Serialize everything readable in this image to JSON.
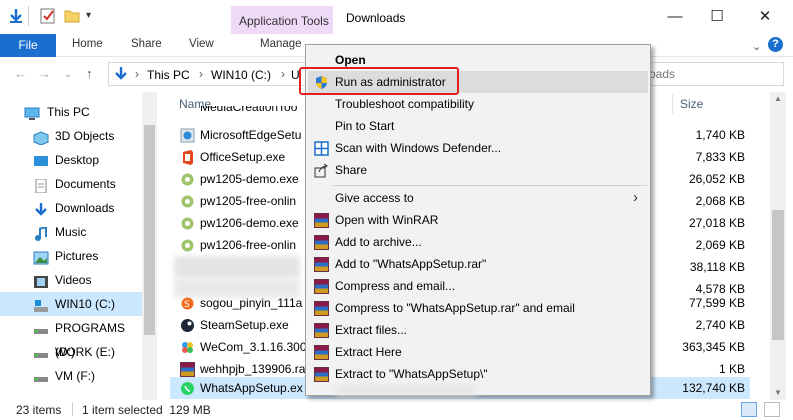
{
  "window": {
    "title": "Downloads",
    "app_tools_tab": "Application Tools",
    "controls": {
      "minimize": "—",
      "maximize": "☐",
      "close": "✕"
    }
  },
  "ribbon": {
    "file": "File",
    "home": "Home",
    "share": "Share",
    "view": "View",
    "manage": "Manage"
  },
  "address": {
    "crumbs": [
      "This PC",
      "WIN10 (C:)",
      "U"
    ],
    "search_placeholder": "oads"
  },
  "nav": {
    "items": [
      {
        "label": "This PC",
        "icon": "monitor-icon"
      },
      {
        "label": "3D Objects",
        "icon": "cube-icon"
      },
      {
        "label": "Desktop",
        "icon": "desktop-icon"
      },
      {
        "label": "Documents",
        "icon": "documents-icon"
      },
      {
        "label": "Downloads",
        "icon": "download-arrow-icon"
      },
      {
        "label": "Music",
        "icon": "music-icon"
      },
      {
        "label": "Pictures",
        "icon": "pictures-icon"
      },
      {
        "label": "Videos",
        "icon": "videos-icon"
      },
      {
        "label": "WIN10 (C:)",
        "icon": "drive-icon"
      },
      {
        "label": "PROGRAMS (D:)",
        "icon": "drive-icon"
      },
      {
        "label": "WORK (E:)",
        "icon": "drive-icon"
      },
      {
        "label": "VM (F:)",
        "icon": "drive-icon"
      }
    ],
    "selected": "WIN10 (C:)"
  },
  "files": {
    "col_name": "Name",
    "col_size": "Size",
    "rows": [
      {
        "name": "MediaCreationToo",
        "size": ""
      },
      {
        "name": "MicrosoftEdgeSetu",
        "size": "1,740 KB"
      },
      {
        "name": "OfficeSetup.exe",
        "size": "7,833 KB"
      },
      {
        "name": "pw1205-demo.exe",
        "size": "26,052 KB"
      },
      {
        "name": "pw1205-free-onlin",
        "size": "2,068 KB"
      },
      {
        "name": "pw1206-demo.exe",
        "size": "27,018 KB"
      },
      {
        "name": "pw1206-free-onlin",
        "size": "2,069 KB"
      },
      {
        "name": "",
        "size": "38,118 KB"
      },
      {
        "name": "",
        "size": "4,578 KB"
      },
      {
        "name": "sogou_pinyin_111a",
        "size": "77,599 KB"
      },
      {
        "name": "SteamSetup.exe",
        "size": "2,740 KB"
      },
      {
        "name": "WeCom_3.1.16.300",
        "size": "363,345 KB"
      },
      {
        "name": "wehhpjb_139906.ra",
        "size": "1 KB"
      },
      {
        "name": "WhatsAppSetup.ex",
        "size": "132,740 KB"
      }
    ]
  },
  "status": {
    "items": "23 items",
    "selected": "1 item selected  129 MB"
  },
  "context_menu": {
    "items": [
      "Open",
      "Run as administrator",
      "Troubleshoot compatibility",
      "Pin to Start",
      "Scan with Windows Defender...",
      "Share",
      "Give access to",
      "Open with WinRAR",
      "Add to archive...",
      "Add to \"WhatsAppSetup.rar\"",
      "Compress and email...",
      "Compress to \"WhatsAppSetup.rar\" and email",
      "Extract files...",
      "Extract Here",
      "Extract to \"WhatsAppSetup\\\""
    ],
    "highlighted": "Run as administrator",
    "submenu_arrow": "›"
  },
  "colors": {
    "accent": "#1a6fce",
    "app_tools": "#f0d9f7",
    "highlight_box": "#e2211c",
    "selection": "#cce8ff"
  }
}
